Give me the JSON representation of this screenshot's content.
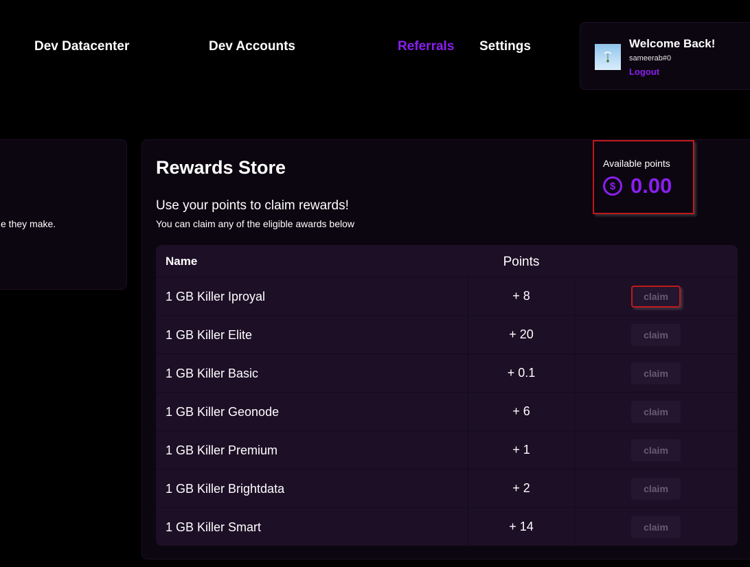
{
  "nav": {
    "items": [
      {
        "label": "Dev Datacenter",
        "active": false
      },
      {
        "label": "Dev Accounts",
        "active": false
      },
      {
        "label": "Referrals",
        "active": true
      },
      {
        "label": "Settings",
        "active": false
      }
    ]
  },
  "user": {
    "welcome": "Welcome Back!",
    "username": "sameerab#0",
    "logout": "Logout"
  },
  "referral_card": {
    "text": "e they make."
  },
  "store": {
    "title": "Rewards Store",
    "subtitle": "Use your points to claim rewards!",
    "description": "You can claim any of the eligible awards below",
    "points": {
      "label": "Available points",
      "icon": "dollar-circle-icon",
      "value": "0.00"
    },
    "table": {
      "headers": {
        "name": "Name",
        "points": "Points"
      },
      "rows": [
        {
          "name": "1 GB Killer Iproyal",
          "points": "+ 8",
          "action": "claim"
        },
        {
          "name": "1 GB Killer Elite",
          "points": "+ 20",
          "action": "claim"
        },
        {
          "name": "1 GB Killer Basic",
          "points": "+ 0.1",
          "action": "claim"
        },
        {
          "name": "1 GB Killer Geonode",
          "points": "+ 6",
          "action": "claim"
        },
        {
          "name": "1 GB Killer Premium",
          "points": "+ 1",
          "action": "claim"
        },
        {
          "name": "1 GB Killer Brightdata",
          "points": "+ 2",
          "action": "claim"
        },
        {
          "name": "1 GB Killer Smart",
          "points": "+ 14",
          "action": "claim"
        }
      ]
    }
  },
  "colors": {
    "accent": "#8a1ff0",
    "background": "#000000",
    "card": "#0c0610",
    "table": "#1d0f26",
    "highlight": "#c0191c"
  }
}
